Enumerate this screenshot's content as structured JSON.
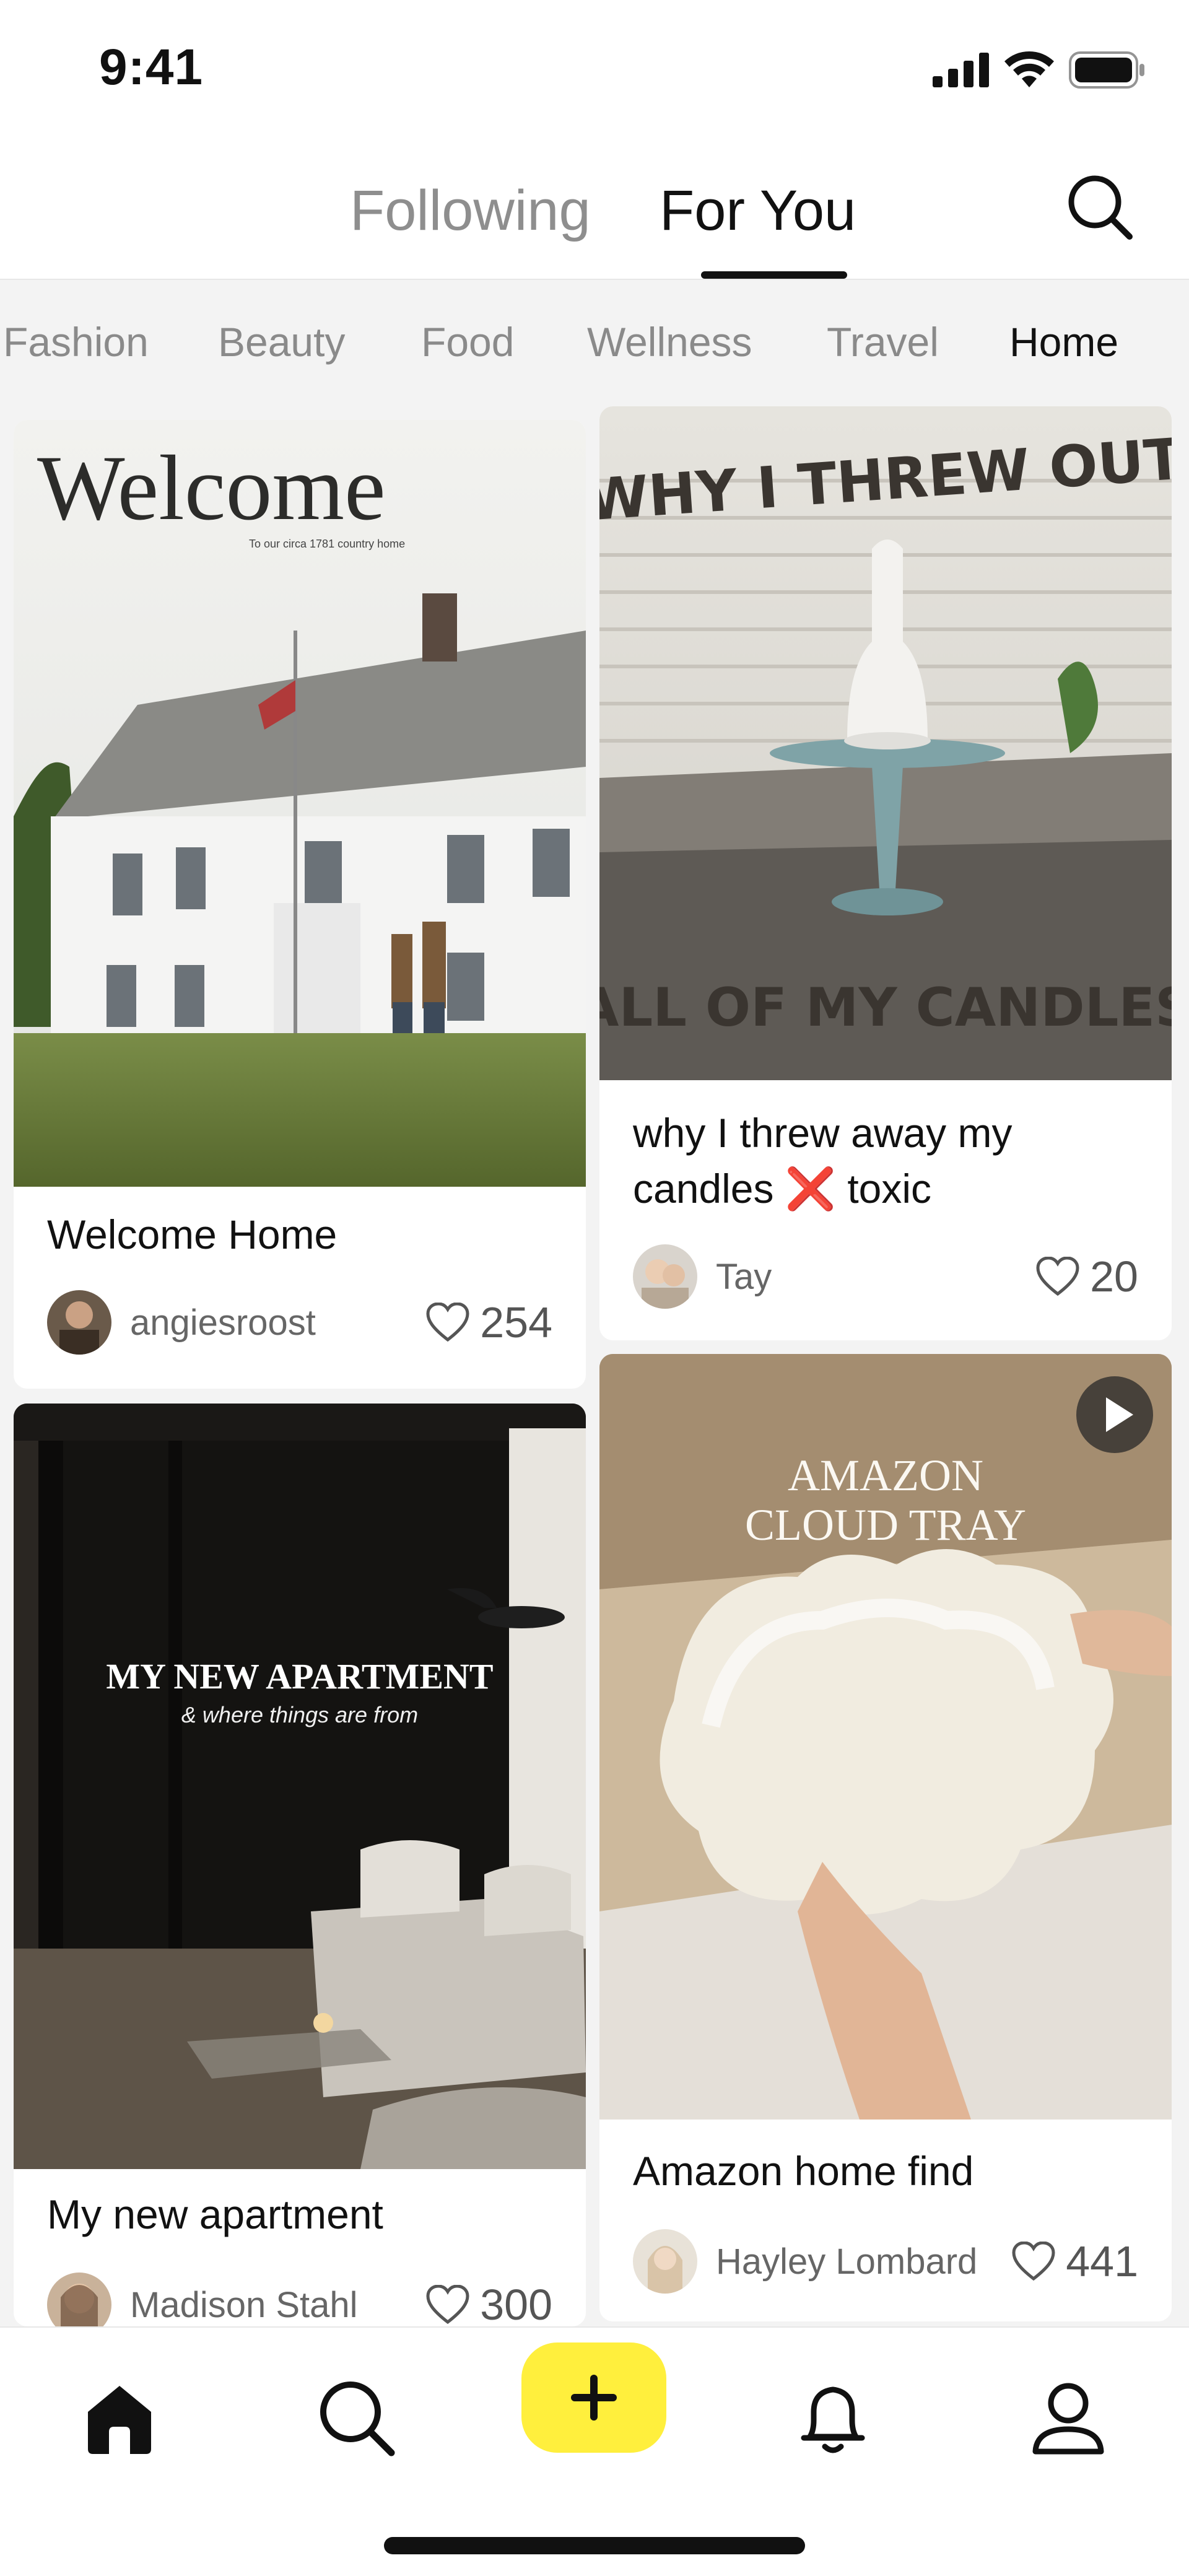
{
  "status_bar": {
    "time": "9:41"
  },
  "top_tabs": {
    "following": "Following",
    "for_you": "For You",
    "active": "For You"
  },
  "categories": [
    "Fashion",
    "Beauty",
    "Food",
    "Wellness",
    "Travel",
    "Home"
  ],
  "active_category": "Home",
  "feed": {
    "left": [
      {
        "title": "Welcome Home",
        "user": "angiesroost",
        "likes": "254",
        "overlay_text": "Welcome",
        "overlay_sub": "To our circa 1781 country home"
      },
      {
        "title": "My new apartment",
        "user": "Madison Stahl",
        "likes": "300",
        "overlay_text": "MY NEW APARTMENT",
        "overlay_sub": "& where things are from"
      }
    ],
    "right": [
      {
        "title": "why I threw away my candles ❌ toxic",
        "user": "Tay",
        "likes": "20",
        "overlay_top": "WHY I THREW OUT",
        "overlay_bottom": "ALL OF MY CANDLES"
      },
      {
        "title": "Amazon home find",
        "user": "Hayley Lombard",
        "likes": "441",
        "overlay_line1": "AMAZON",
        "overlay_line2": "CLOUD TRAY",
        "is_video": true
      }
    ]
  },
  "bottom_nav": [
    "home-icon",
    "search-icon",
    "plus-icon",
    "bell-icon",
    "profile-icon"
  ],
  "colors": {
    "accent_yellow": "#ffef3d",
    "text": "#111111",
    "muted": "#8a8a8a"
  }
}
